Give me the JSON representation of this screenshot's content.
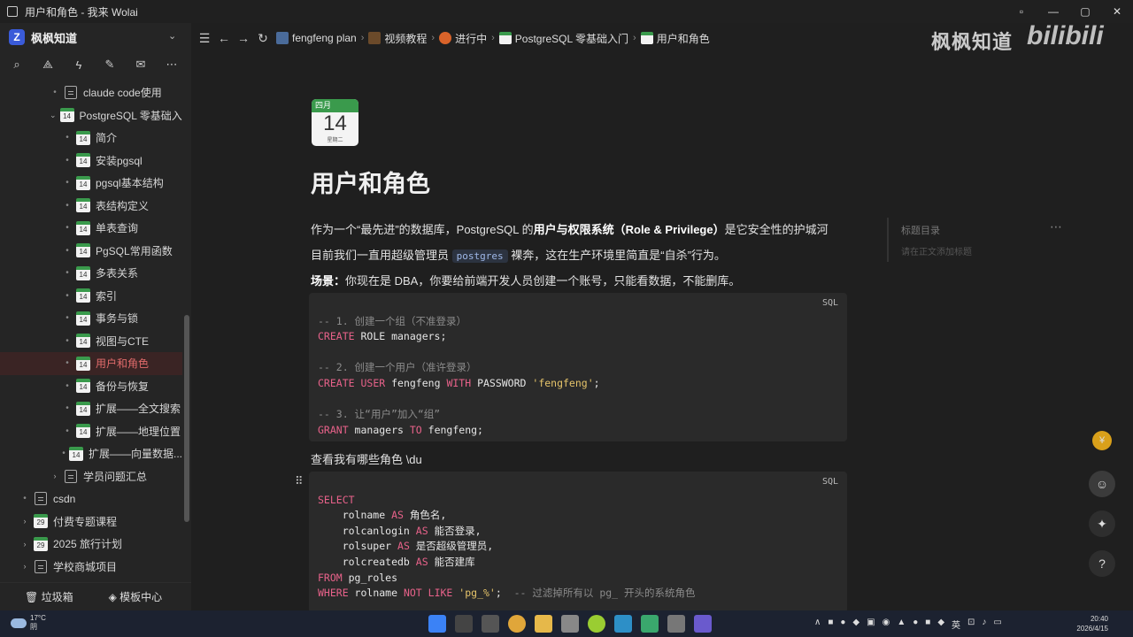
{
  "window": {
    "title": "用户和角色 - 我来 Wolai",
    "controls": [
      "▫",
      "—",
      "▢",
      "✕"
    ]
  },
  "sidebar": {
    "workspace_name": "枫枫知道",
    "workspace_logo": "Z",
    "tools": [
      "search-icon",
      "graph-icon",
      "lightning-icon",
      "edit-icon",
      "inbox-icon",
      "more-icon"
    ],
    "tree": [
      {
        "label": "claude code使用",
        "icon": "doc",
        "level": 2,
        "arrow": "•"
      },
      {
        "label": "PostgreSQL 零基础入...",
        "icon": "cal",
        "level": 2,
        "arrow": "⌄"
      },
      {
        "label": "简介",
        "icon": "cal",
        "level": 3,
        "arrow": "•"
      },
      {
        "label": "安装pgsql",
        "icon": "cal",
        "level": 3,
        "arrow": "•"
      },
      {
        "label": "pgsql基本结构",
        "icon": "cal",
        "level": 3,
        "arrow": "•"
      },
      {
        "label": "表结构定义",
        "icon": "cal",
        "level": 3,
        "arrow": "•"
      },
      {
        "label": "单表查询",
        "icon": "cal",
        "level": 3,
        "arrow": "•"
      },
      {
        "label": "PgSQL常用函数",
        "icon": "cal",
        "level": 3,
        "arrow": "•"
      },
      {
        "label": "多表关系",
        "icon": "cal",
        "level": 3,
        "arrow": "•"
      },
      {
        "label": "索引",
        "icon": "cal",
        "level": 3,
        "arrow": "•"
      },
      {
        "label": "事务与锁",
        "icon": "cal",
        "level": 3,
        "arrow": "•"
      },
      {
        "label": "视图与CTE",
        "icon": "cal",
        "level": 3,
        "arrow": "•"
      },
      {
        "label": "用户和角色",
        "icon": "cal",
        "level": 3,
        "arrow": "•",
        "active": true
      },
      {
        "label": "备份与恢复",
        "icon": "cal",
        "level": 3,
        "arrow": "•"
      },
      {
        "label": "扩展——全文搜索",
        "icon": "cal",
        "level": 3,
        "arrow": "•"
      },
      {
        "label": "扩展——地理位置",
        "icon": "cal",
        "level": 3,
        "arrow": "•"
      },
      {
        "label": "扩展——向量数据...",
        "icon": "cal",
        "level": 3,
        "arrow": "•"
      },
      {
        "label": "学员问题汇总",
        "icon": "doc",
        "level": 2,
        "arrow": "›"
      },
      {
        "label": "csdn",
        "icon": "doc",
        "level": 1,
        "arrow": "•"
      },
      {
        "label": "付费专题课程",
        "icon": "cal29",
        "level": 1,
        "arrow": "›"
      },
      {
        "label": "2025 旅行计划",
        "icon": "cal29",
        "level": 1,
        "arrow": "›"
      },
      {
        "label": "学校商城项目",
        "icon": "doc",
        "level": 1,
        "arrow": "›"
      }
    ],
    "bottom": {
      "trash": "垃圾箱",
      "templates": "模板中心"
    }
  },
  "toolbar": {
    "breadcrumbs": [
      "fengfeng plan",
      "视频教程",
      "进行中",
      "PostgreSQL 零基础入门",
      "用户和角色"
    ]
  },
  "watermark": {
    "text": "枫枫知道",
    "brand": "bilibili"
  },
  "doc": {
    "calendar": {
      "month": "四月",
      "day": "14",
      "weekday": "星期二"
    },
    "title": "用户和角色",
    "p1_pre": "作为一个“最先进”的数据库，PostgreSQL 的",
    "p1_bold": "用户与权限系统（Role & Privilege）",
    "p1_post": "是它安全性的护城河",
    "p2_pre": "目前我们一直用超级管理员",
    "p2_code": "postgres",
    "p2_post": "裸奔，这在生产环境里简直是“自杀”行为。",
    "p3_bold": "场景：",
    "p3_post": "你现在是 DBA，你要给前端开发人员创建一个账号，只能看数据，不能删库。",
    "code1_lang": "SQL",
    "code1": [
      [],
      [
        [
          "cm",
          "-- 1. 创建一个组（不准登录）"
        ]
      ],
      [
        [
          "kw",
          "CREATE"
        ],
        [
          "",
          " ROLE managers;"
        ]
      ],
      [],
      [
        [
          "cm",
          "-- 2. 创建一个用户（准许登录）"
        ]
      ],
      [
        [
          "kw",
          "CREATE"
        ],
        [
          "",
          " "
        ],
        [
          "kw",
          "USER"
        ],
        [
          "",
          " fengfeng "
        ],
        [
          "kw",
          "WITH"
        ],
        [
          "",
          " PASSWORD "
        ],
        [
          "str",
          "'fengfeng'"
        ],
        [
          "",
          ";"
        ]
      ],
      [],
      [
        [
          "cm",
          "-- 3. 让“用户”加入“组”"
        ]
      ],
      [
        [
          "kw",
          "GRANT"
        ],
        [
          "",
          " managers "
        ],
        [
          "kw",
          "TO"
        ],
        [
          "",
          " fengfeng;"
        ]
      ]
    ],
    "p4": "查看我有哪些角色 \\du",
    "code2_lang": "SQL",
    "code2": [
      [],
      [
        [
          "kw",
          "SELECT"
        ]
      ],
      [
        [
          "",
          "    rolname "
        ],
        [
          "kw",
          "AS"
        ],
        [
          "",
          " 角色名,"
        ]
      ],
      [
        [
          "",
          "    rolcanlogin "
        ],
        [
          "kw",
          "AS"
        ],
        [
          "",
          " 能否登录,"
        ]
      ],
      [
        [
          "",
          "    rolsuper "
        ],
        [
          "kw",
          "AS"
        ],
        [
          "",
          " 是否超级管理员,"
        ]
      ],
      [
        [
          "",
          "    rolcreatedb "
        ],
        [
          "kw",
          "AS"
        ],
        [
          "",
          " 能否建库"
        ]
      ],
      [
        [
          "kw",
          "FROM"
        ],
        [
          "",
          " pg_roles"
        ]
      ],
      [
        [
          "kw",
          "WHERE"
        ],
        [
          "",
          " rolname "
        ],
        [
          "kw",
          "NOT"
        ],
        [
          "",
          " "
        ],
        [
          "kw",
          "LIKE"
        ],
        [
          "",
          " "
        ],
        [
          "str",
          "'pg_%'"
        ],
        [
          "",
          ";  "
        ],
        [
          "cm",
          "-- 过滤掉所有以 pg_ 开头的系统角色"
        ]
      ]
    ]
  },
  "outline": {
    "title": "标题目录",
    "hint": "请在正文添加标题"
  },
  "taskbar": {
    "temp": "17°C",
    "weather": "阴",
    "time": "20:40",
    "date": "2026/4/15",
    "ime": "英"
  },
  "colors": {
    "accent": "#e06b6b",
    "keyword": "#e8628a",
    "string": "#e6c46a",
    "comment": "#8b8b8b",
    "calendar_green": "#3a9a4c"
  }
}
